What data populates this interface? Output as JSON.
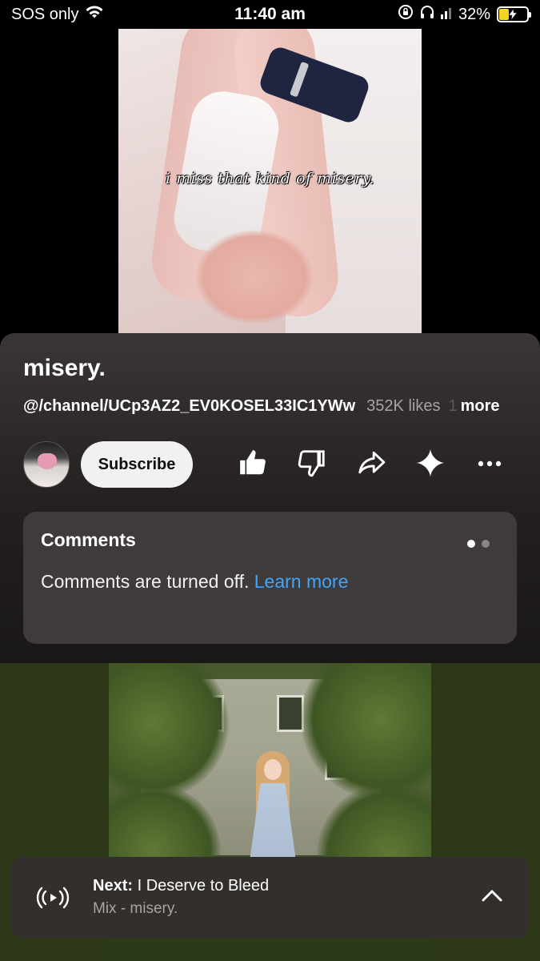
{
  "status_bar": {
    "carrier": "SOS only",
    "time": "11:40 am",
    "battery": "32%",
    "battery_level": 0.32,
    "battery_color": "#f5d31e"
  },
  "video": {
    "caption": "i miss that kind of misery."
  },
  "info": {
    "title": "misery.",
    "channel_handle": "@/channel/UCp3AZ2_EV0KOSEL33IC1YWw",
    "likes": "352K likes",
    "more_fade": "1",
    "more": "more",
    "subscribe_label": "Subscribe",
    "icons": [
      "like-icon",
      "dislike-icon",
      "share-icon",
      "sparkle-icon",
      "more-options-icon"
    ]
  },
  "comments": {
    "title": "Comments",
    "text": "Comments are turned off.",
    "link": "Learn more",
    "link_color": "#3ea6ff"
  },
  "next": {
    "label": "Next:",
    "title": "I Deserve to Bleed",
    "subtitle": "Mix - misery."
  }
}
